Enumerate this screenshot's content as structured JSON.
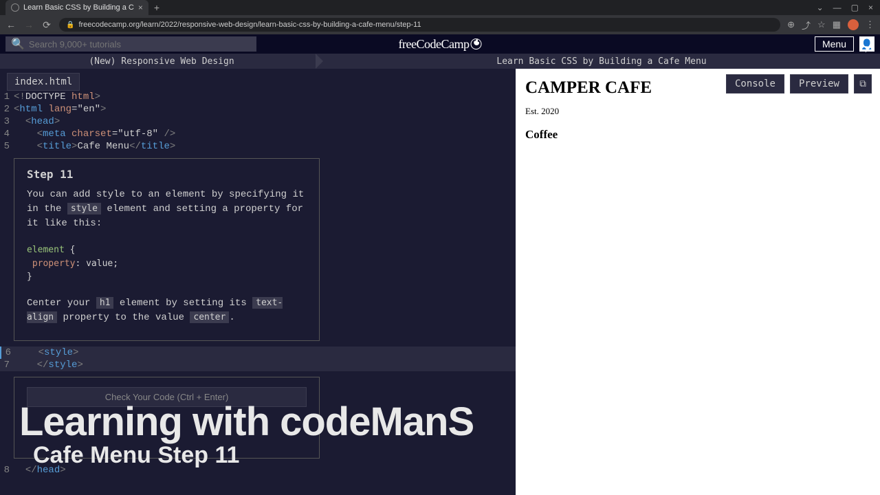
{
  "browser": {
    "tab_title": "Learn Basic CSS by Building a C",
    "url": "freecodecamp.org/learn/2022/responsive-web-design/learn-basic-css-by-building-a-cafe-menu/step-11"
  },
  "fcc_header": {
    "search_placeholder": "Search 9,000+ tutorials",
    "logo_text": "freeCodeCamp",
    "menu_label": "Menu"
  },
  "course": {
    "track": "(New) Responsive Web Design",
    "lesson": "Learn Basic CSS by Building a Cafe Menu"
  },
  "editor": {
    "file_tab": "index.html",
    "console_btn": "Console",
    "preview_btn": "Preview"
  },
  "code": {
    "l1_open": "<!",
    "l1_doctype": "DOCTYPE",
    "l1_html": "html",
    "l1_close": ">",
    "l2_open": "<",
    "l2_tag": "html",
    "l2_attr": "lang",
    "l2_eq": "=",
    "l2_val": "\"en\"",
    "l2_close": ">",
    "l3": "<head>",
    "l4_open": "<",
    "l4_tag": "meta",
    "l4_attr": "charset",
    "l4_eq": "=",
    "l4_val": "\"utf-8\"",
    "l4_close": " />",
    "l5_open": "<",
    "l5_tag": "title",
    "l5_mid": ">",
    "l5_text": "Cafe Menu",
    "l5_closeopen": "</",
    "l5_closemid": ">",
    "l6_open": "<",
    "l6_tag": "style",
    "l6_close": ">",
    "l7_open": "</",
    "l7_tag": "style",
    "l7_close": ">",
    "l8": "</head>"
  },
  "step": {
    "title": "Step 11",
    "para1_a": "You can add style to an element by specifying it in the ",
    "para1_code": "style",
    "para1_b": " element and setting a property for it like this:",
    "example_selector": "element",
    "example_brace_open": " {",
    "example_prop": "property",
    "example_rest": ": value;",
    "example_brace_close": "}",
    "para2_a": "Center your ",
    "para2_code1": "h1",
    "para2_b": " element by setting its ",
    "para2_code2": "text-align",
    "para2_c": " property to the value ",
    "para2_code3": "center",
    "para2_d": "."
  },
  "feedback": {
    "check_label": "Check Your Code (Ctrl + Enter)"
  },
  "preview": {
    "h1": "CAMPER CAFE",
    "est": "Est. 2020",
    "h2": "Coffee"
  },
  "overlay": {
    "line1": "Learning with codeManS",
    "line2": "Cafe Menu Step 11"
  }
}
